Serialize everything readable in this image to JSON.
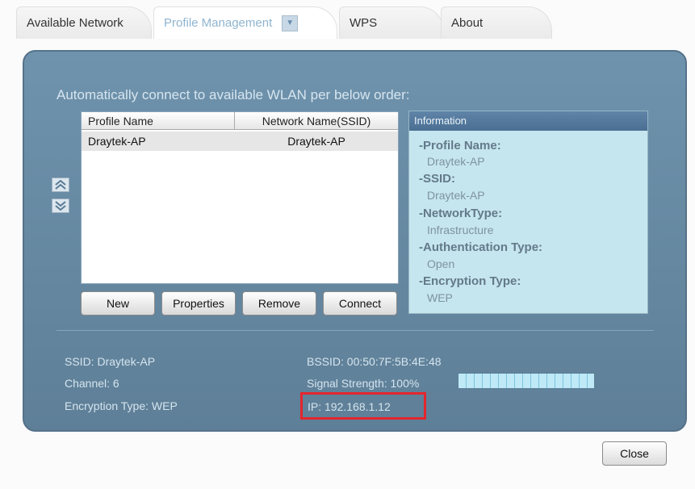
{
  "tabs": {
    "available_network": "Available Network",
    "profile_management": "Profile Management",
    "wps": "WPS",
    "about": "About"
  },
  "auto_connect_text": "Automatically connect to available WLAN per below order:",
  "profile_table": {
    "headers": [
      "Profile Name",
      "Network Name(SSID)"
    ],
    "rows": [
      {
        "profile": "Draytek-AP",
        "ssid": "Draytek-AP"
      }
    ]
  },
  "information": {
    "title": "Information",
    "profile_name_label": "-Profile Name:",
    "profile_name_value": "Draytek-AP",
    "ssid_label": "-SSID:",
    "ssid_value": "Draytek-AP",
    "network_type_label": "-NetworkType:",
    "network_type_value": "Infrastructure",
    "auth_type_label": "-Authentication Type:",
    "auth_type_value": "Open",
    "enc_type_label": "-Encryption Type:",
    "enc_type_value": "WEP"
  },
  "buttons": {
    "new": "New",
    "properties": "Properties",
    "remove": "Remove",
    "connect": "Connect",
    "close": "Close"
  },
  "status": {
    "ssid": "SSID: Draytek-AP",
    "channel": "Channel: 6",
    "encryption": "Encryption Type: WEP",
    "bssid": "BSSID: 00:50:7F:5B:4E:48",
    "signal_label": "Signal Strength: 100%",
    "signal_value": 1.0,
    "ip": "IP: 192.168.1.12"
  },
  "icons": {
    "move_up": "double-chevron-up-icon",
    "move_down": "double-chevron-down-icon",
    "tab_dropdown": "dropdown-arrow-icon"
  },
  "colors": {
    "panel": "#6a8ca5",
    "info_bg": "#c5e6ee",
    "highlight_border": "#e4262d"
  }
}
